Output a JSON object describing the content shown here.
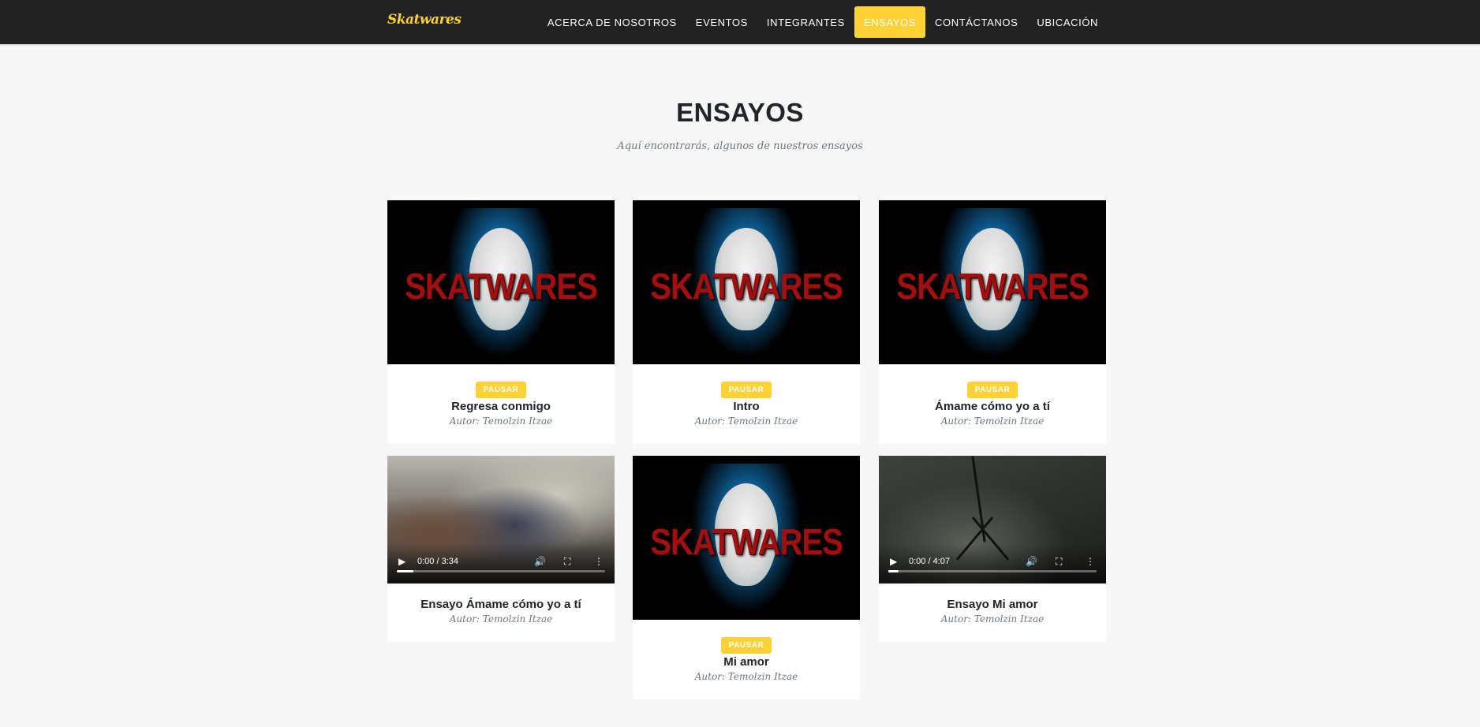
{
  "nav": {
    "brand": "Skatwares",
    "items": [
      {
        "label": "Acerca de nosotros",
        "active": false
      },
      {
        "label": "Eventos",
        "active": false
      },
      {
        "label": "Integrantes",
        "active": false
      },
      {
        "label": "Ensayos",
        "active": true
      },
      {
        "label": "Contáctanos",
        "active": false
      },
      {
        "label": "Ubicación",
        "active": false
      }
    ]
  },
  "section": {
    "title": "ENSAYOS",
    "subtitle": "Aquí encontrarás, algunos de nuestros ensayos"
  },
  "logo_text": "SKATWARES",
  "cards": [
    {
      "title": "Regresa conmigo",
      "author": "Autor: Temolzin Itzae",
      "button": "PAUSAR"
    },
    {
      "title": "Intro",
      "author": "Autor: Temolzin Itzae",
      "button": "PAUSAR"
    },
    {
      "title": "Ámame cómo yo a tí",
      "author": "Autor: Temolzin Itzae",
      "button": "PAUSAR"
    },
    {
      "title": "Ensayo Ámame cómo yo a tí",
      "author": "Autor: Temolzin Itzae",
      "time": "0:00 / 3:34",
      "progress": 0.08
    },
    {
      "title": "Mi amor",
      "author": "Autor: Temolzin Itzae",
      "button": "PAUSAR"
    },
    {
      "title": "Ensayo Mi amor",
      "author": "Autor: Temolzin Itzae",
      "time": "0:00 / 4:07",
      "progress": 0.05
    }
  ],
  "icons": {
    "play": "play-icon",
    "volume": "volume-icon",
    "fullscreen": "fullscreen-icon",
    "more": "more-vertical-icon"
  },
  "colors": {
    "accent": "#fed136",
    "navbar": "#222222",
    "background": "#f7f7f7"
  }
}
